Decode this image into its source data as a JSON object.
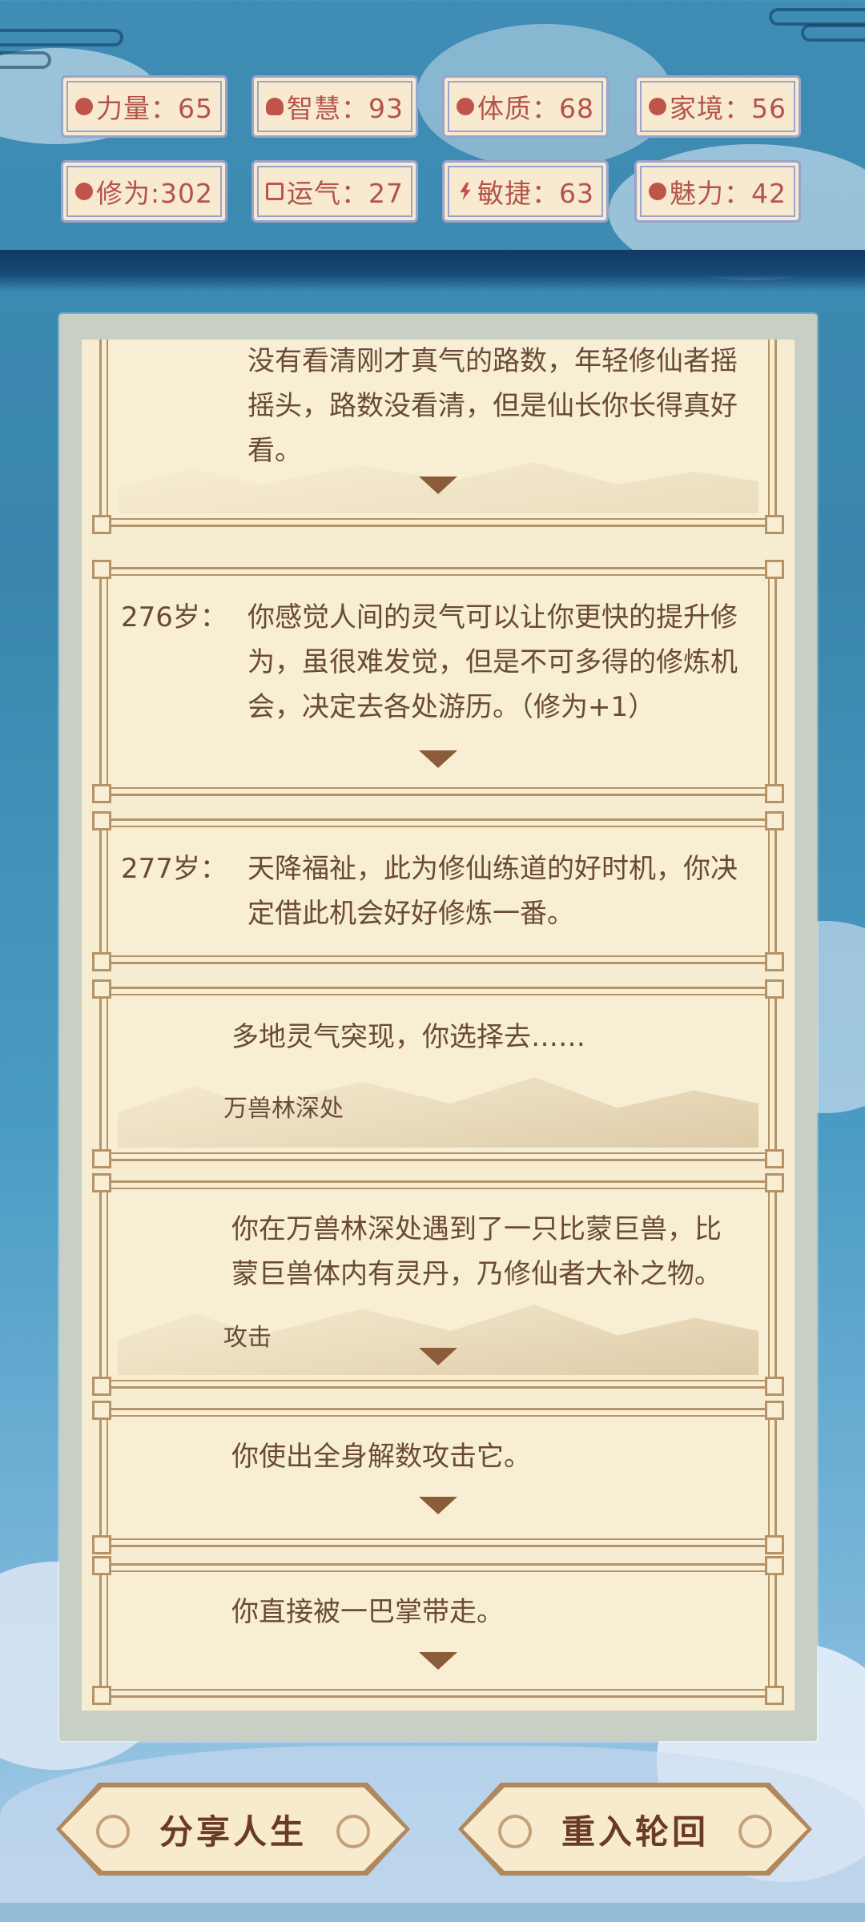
{
  "stats": [
    {
      "icon": "muscle-icon",
      "label": "力量：65"
    },
    {
      "icon": "bulb-icon",
      "label": "智慧：93"
    },
    {
      "icon": "constitution-icon",
      "label": "体质：68"
    },
    {
      "icon": "family-icon",
      "label": "家境：56"
    },
    {
      "icon": "cloud-icon",
      "label": "修为:302"
    },
    {
      "icon": "luck-icon",
      "label": "运气：27"
    },
    {
      "icon": "lightning-icon",
      "label": "敏捷：63"
    },
    {
      "icon": "heart-icon",
      "label": "魅力：42"
    }
  ],
  "events": [
    {
      "age": "",
      "text_lines": [
        "没有看清刚才真气的路数，年轻修仙者摇",
        "摇头，路数没看清，但是仙长你长得真好",
        "看。"
      ]
    },
    {
      "age": "276岁：",
      "text_lines": [
        "你感觉人间的灵气可以让你更快的提升修",
        "为，虽很难发觉，但是不可多得的修炼机",
        "会，决定去各处游历。（修为+1）"
      ]
    },
    {
      "age": "277岁：",
      "text_lines": [
        "天降福祉，此为修仙练道的好时机，你决",
        "定借此机会好好修炼一番。"
      ]
    },
    {
      "age": "",
      "text_lines": [
        "多地灵气突现，你选择去……"
      ],
      "option": "万兽林深处"
    },
    {
      "age": "",
      "text_lines": [
        "你在万兽林深处遇到了一只比蒙巨兽，比",
        "蒙巨兽体内有灵丹，乃修仙者大补之物。"
      ],
      "option": "攻击"
    },
    {
      "age": "",
      "text_lines": [
        "你使出全身解数攻击它。"
      ]
    },
    {
      "age": "",
      "text_lines": [
        "你直接被一巴掌带走。"
      ]
    }
  ],
  "buttons": {
    "share": "分享人生",
    "restart": "重入轮回"
  },
  "colors": {
    "stat_text": "#b4534a",
    "stat_border": "#9aa3c9",
    "card_bg": "#f8eed4",
    "card_border": "#b59366",
    "text_brown": "#6a4a36"
  }
}
